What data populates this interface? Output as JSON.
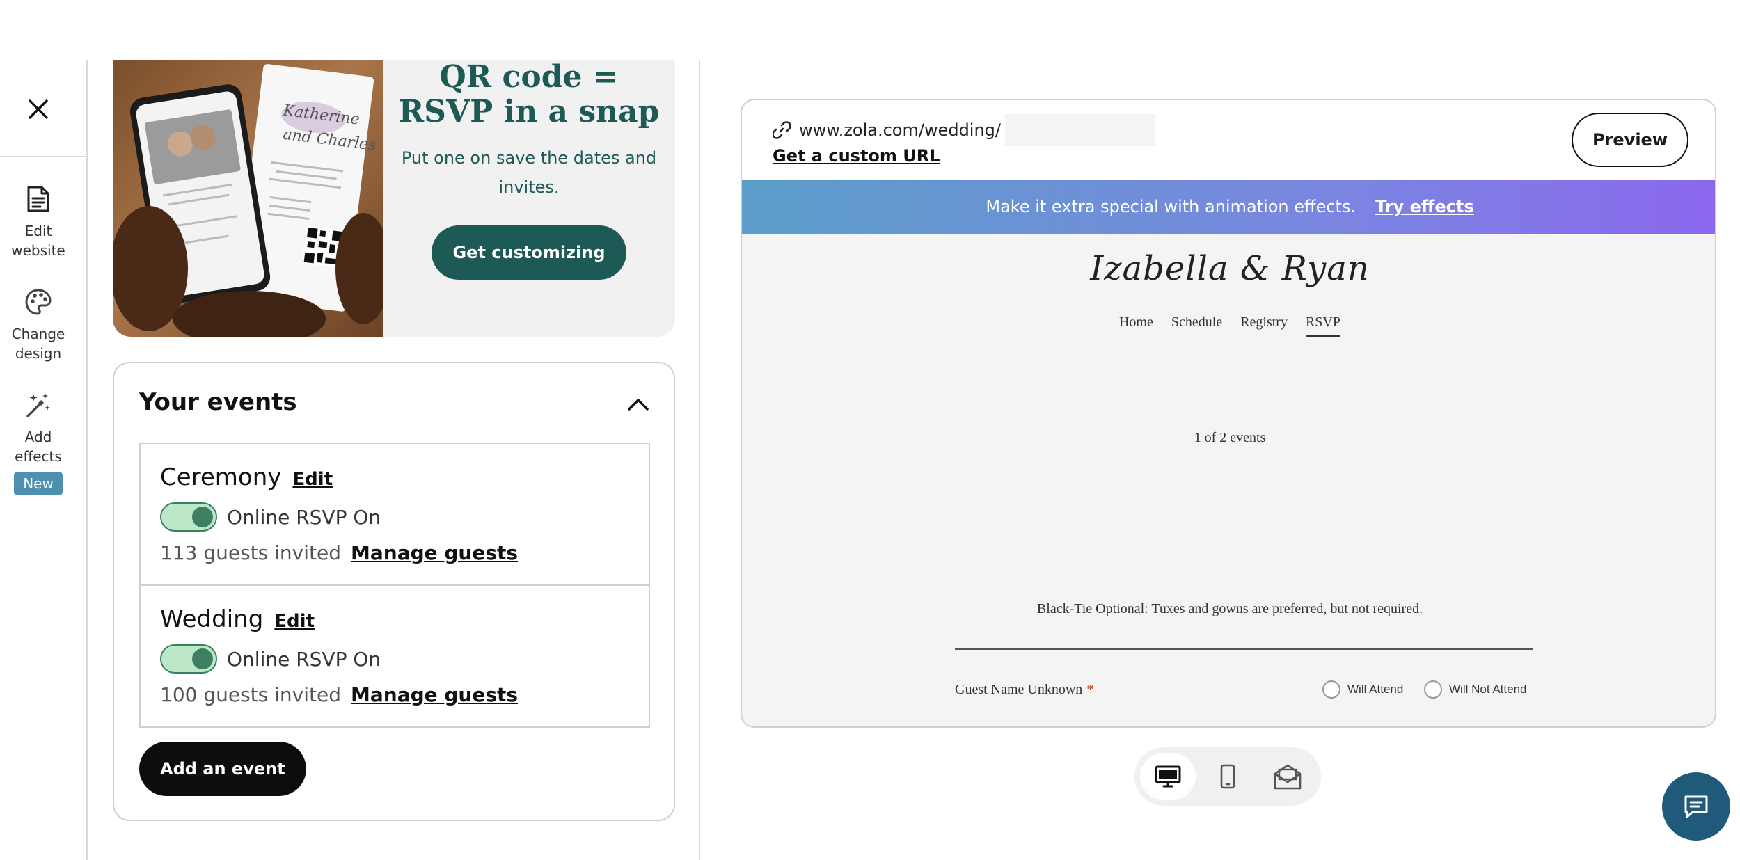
{
  "rail": {
    "items": [
      {
        "label": "Edit\nwebsite",
        "icon": "document-icon"
      },
      {
        "label": "Change\ndesign",
        "icon": "palette-icon"
      },
      {
        "label": "Add\neffects",
        "icon": "magic-wand-icon",
        "badge": "New"
      }
    ]
  },
  "promo": {
    "title": "QR code =\nRSVP in a snap",
    "subtitle": "Put one on save the dates and invites.",
    "button": "Get customizing",
    "invite_script": [
      "Katherine",
      "and Charles"
    ]
  },
  "events": {
    "title": "Your events",
    "items": [
      {
        "name": "Ceremony",
        "edit": "Edit",
        "rsvp": "Online RSVP On",
        "rsvp_on": true,
        "guests": "113 guests invited",
        "manage": "Manage guests"
      },
      {
        "name": "Wedding",
        "edit": "Edit",
        "rsvp": "Online RSVP On",
        "rsvp_on": true,
        "guests": "100 guests invited",
        "manage": "Manage guests"
      }
    ],
    "add_button": "Add an event"
  },
  "preview": {
    "url": "www.zola.com/wedding/",
    "custom_url": "Get a custom URL",
    "button": "Preview",
    "effects_message": "Make it extra special with animation effects.",
    "effects_link": "Try effects",
    "couple": "Izabella & Ryan",
    "nav": [
      "Home",
      "Schedule",
      "Registry",
      "RSVP"
    ],
    "nav_active": "RSVP",
    "event_count": "1 of 2 events",
    "dress_code": "Black-Tie Optional: Tuxes and gowns are preferred, but not required.",
    "guest_name": "Guest Name Unknown",
    "required_mark": "*",
    "options": [
      "Will Attend",
      "Will Not Attend"
    ]
  },
  "device_switch": {
    "options": [
      "desktop-icon",
      "mobile-icon",
      "envelope-icon"
    ],
    "active": "desktop-icon"
  },
  "colors": {
    "accent_teal": "#1e5a55",
    "toggle_green": "#3d7f62",
    "badge_blue": "#4f8fb0",
    "effects_gradient_start": "#5b9ec9",
    "effects_gradient_end": "#8b68ee",
    "chat_blue": "#1f5a7a"
  }
}
